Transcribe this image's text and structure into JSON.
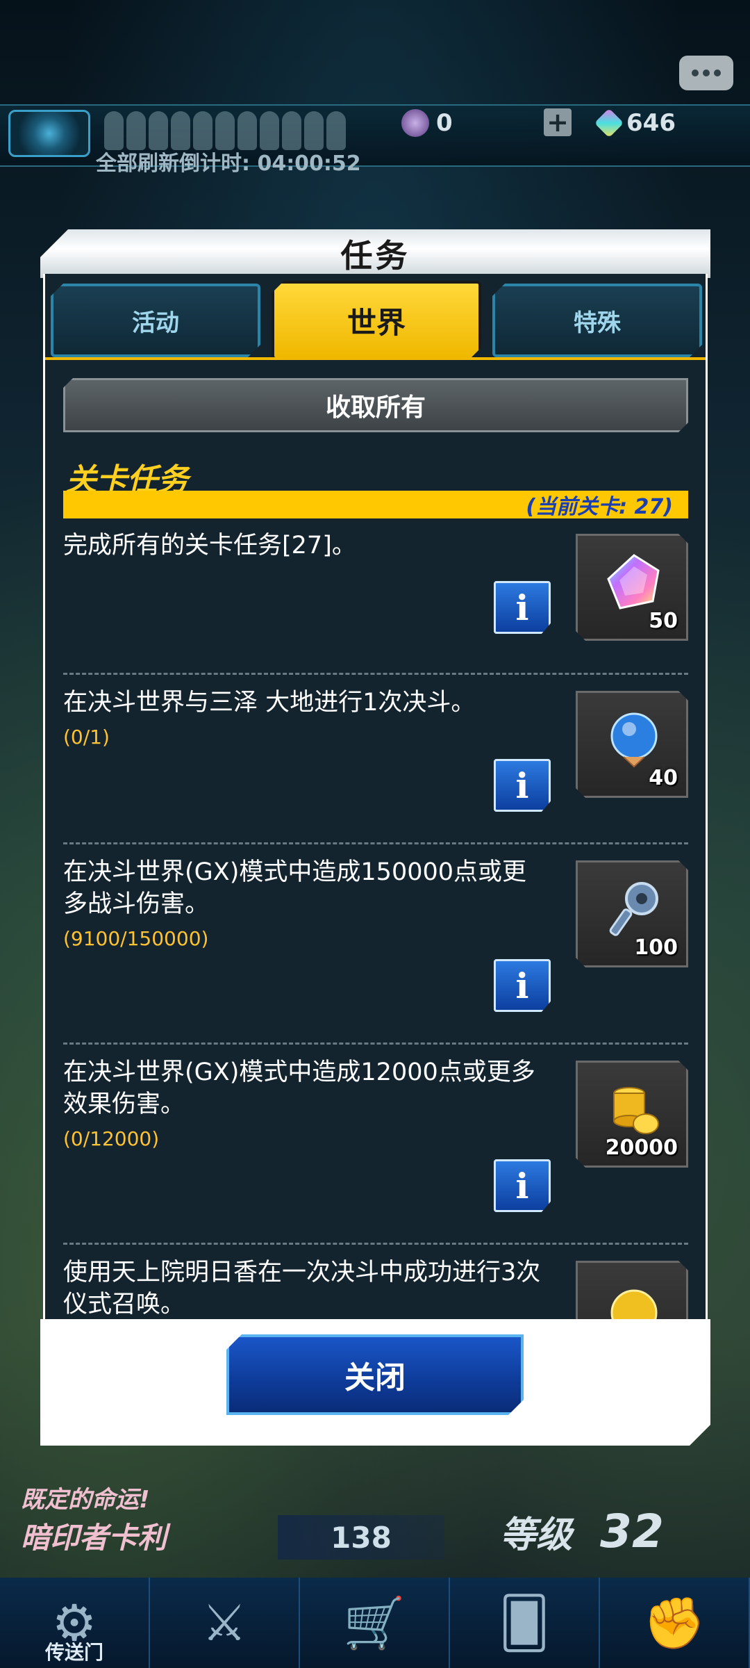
{
  "hud": {
    "resource_coin": "0",
    "resource_gems": "646",
    "refresh_countdown": "全部刷新倒计时: 04:00:52"
  },
  "modal": {
    "title": "任务",
    "tabs": [
      {
        "label": "活动"
      },
      {
        "label": "世界",
        "active": true
      },
      {
        "label": "特殊"
      }
    ],
    "collect_all": "收取所有",
    "section_title": "关卡任务",
    "current_stage": "(当前关卡: 27)",
    "missions": [
      {
        "text": "完成所有的关卡任务[27]。",
        "progress": "",
        "reward_icon": "rainbow-gem-icon",
        "reward_count": "50"
      },
      {
        "text": "在决斗世界与三泽 大地进行1次决斗。",
        "progress": "(0/1)",
        "reward_icon": "ultra-rare-orb-icon",
        "reward_count": "40"
      },
      {
        "text": "在决斗世界(GX)模式中造成150000点或更多战斗伤害。",
        "progress": "(9100/150000)",
        "reward_icon": "key-icon",
        "reward_count": "100"
      },
      {
        "text": "在决斗世界(GX)模式中造成12000点或更多效果伤害。",
        "progress": "(0/12000)",
        "reward_icon": "gold-coins-icon",
        "reward_count": "20000"
      },
      {
        "text": "使用天上院明日香在一次决斗中成功进行3次仪式召唤。",
        "progress": "",
        "reward_icon": "orb-icon",
        "reward_count": ""
      }
    ],
    "close_label": "关闭"
  },
  "bottom": {
    "deck_line1": "既定的命运!",
    "deck_line2": "暗印者卡利",
    "gem_count": "138",
    "level_label": "等级",
    "level_value": "32",
    "nav": [
      {
        "icon": "portal-icon",
        "label": "传送门"
      },
      {
        "icon": "swords-icon",
        "label": ""
      },
      {
        "icon": "shop-cart-icon",
        "label": ""
      },
      {
        "icon": "cards-icon",
        "label": ""
      },
      {
        "icon": "ranking-icon",
        "label": ""
      }
    ]
  },
  "colors": {
    "accent_yellow": "#ffc800",
    "progress_orange": "#ffc230",
    "info_blue": "#2c7ae0"
  }
}
